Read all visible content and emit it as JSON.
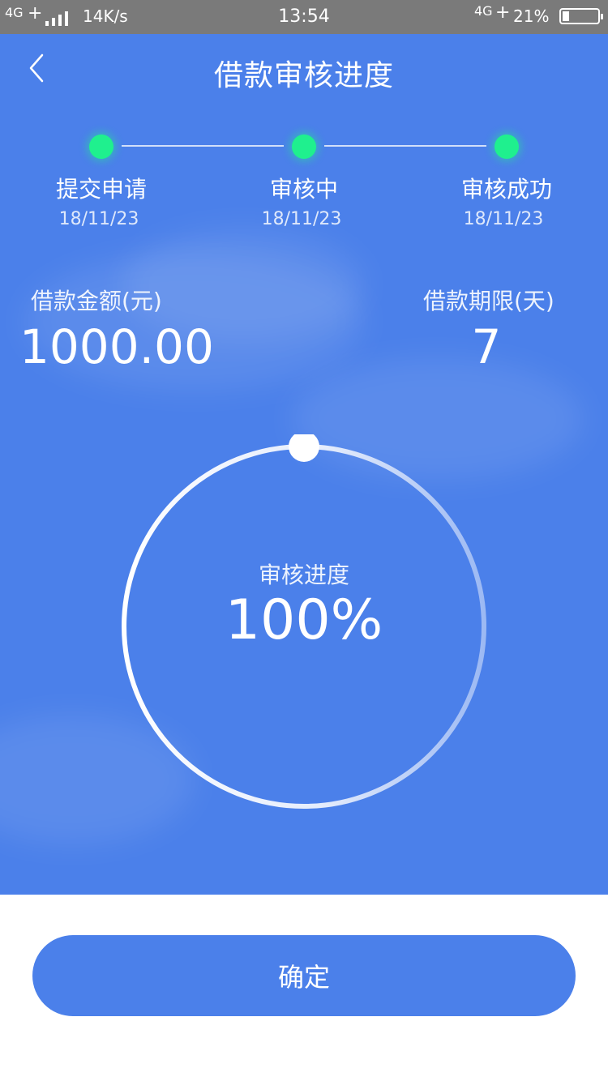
{
  "status_bar": {
    "network_left": "4G",
    "plus_left": "+",
    "speed": "14K/s",
    "time": "13:54",
    "network_right": "4G",
    "plus_right": "+",
    "battery": "21%",
    "battery_level": 0.21
  },
  "header": {
    "back_icon": "chevron-left-icon",
    "title": "借款审核进度"
  },
  "steps": [
    {
      "label": "提交申请",
      "date": "18/11/23"
    },
    {
      "label": "审核中",
      "date": "18/11/23"
    },
    {
      "label": "审核成功",
      "date": "18/11/23"
    }
  ],
  "loan": {
    "amount_label": "借款金额(元)",
    "amount_value": "1000.00",
    "term_label": "借款期限(天)",
    "term_value": "7"
  },
  "progress": {
    "caption": "审核进度",
    "value_text": "100%",
    "value": 1.0
  },
  "footer": {
    "confirm_label": "确定"
  },
  "colors": {
    "primary": "#4b80ea",
    "step_dot": "#1ff08e",
    "status_bar": "#7a7a7a"
  }
}
